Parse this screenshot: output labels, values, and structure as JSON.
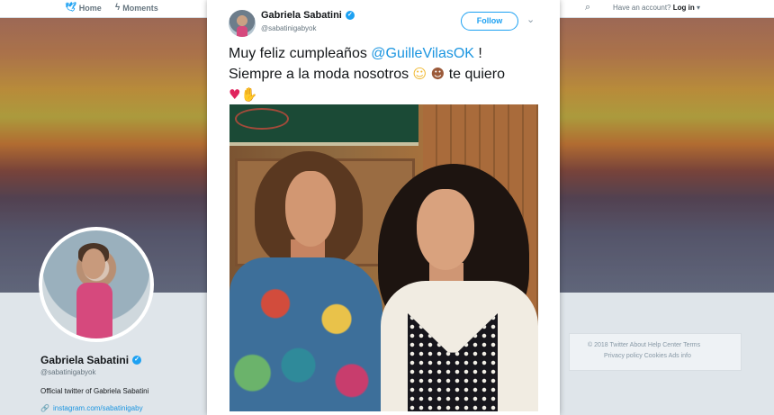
{
  "topnav": {
    "home_label": "Home",
    "moments_label": "Moments",
    "account_prompt": "Have an account?",
    "login_label": "Log in",
    "login_caret": "▾"
  },
  "profile": {
    "name": "Gabriela Sabatini",
    "handle": "@sabatinigabyok",
    "bio": "Official twitter of Gabriela Sabatini",
    "link": "instagram.com/sabatinigaby"
  },
  "footer": {
    "line1": "© 2018 Twitter   About   Help Center   Terms",
    "line2": "Privacy policy   Cookies   Ads info"
  },
  "tweet": {
    "author_name": "Gabriela Sabatini",
    "author_handle": "@sabatinigabyok",
    "follow_label": "Follow",
    "text_part1": "Muy feliz cumpleaños ",
    "mention": "@GuilleVilasOK",
    "text_part2": " !",
    "text_line2": "Siempre a la moda nosotros ",
    "text_after_emoji": " te quiero",
    "emoji_laugh": "☺",
    "emoji_monkey": "☻",
    "emoji_heart": "♥",
    "emoji_hands": "✋"
  },
  "colors": {
    "accent": "#1da1f2",
    "mention": "#1b95e0",
    "heart": "#e0245e"
  },
  "icons": {
    "verified": "verified-badge-icon",
    "search": "search-icon",
    "chevron": "chevron-down-icon"
  }
}
